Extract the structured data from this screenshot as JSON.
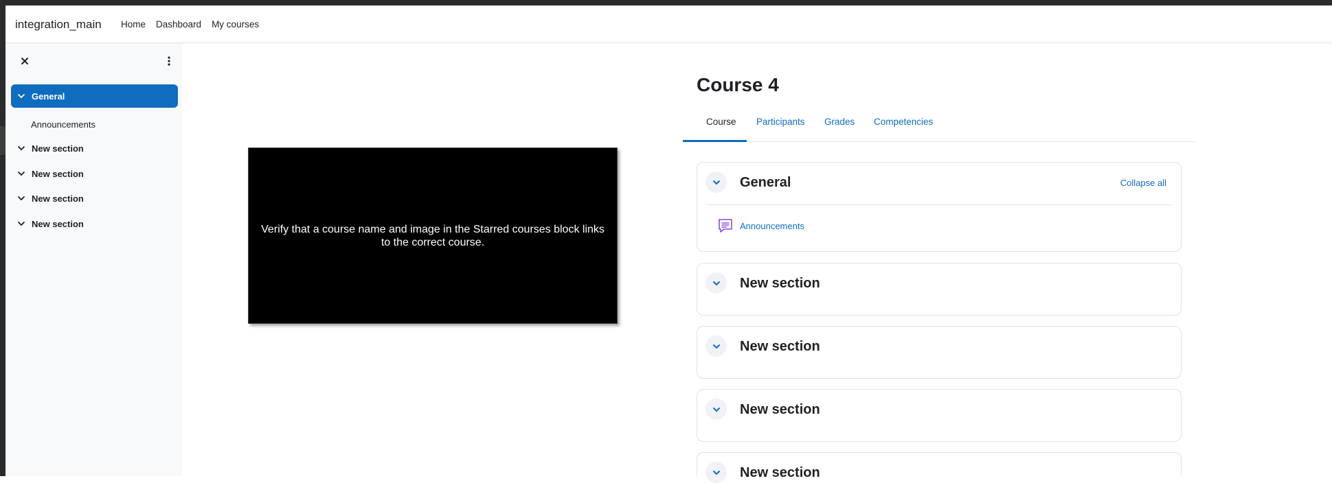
{
  "navbar": {
    "brand": "integration_main",
    "links": [
      "Home",
      "Dashboard",
      "My courses"
    ]
  },
  "drawer": {
    "close_icon": "close-icon",
    "menu_icon": "kebab-menu-icon",
    "items": [
      {
        "label": "General",
        "active": true
      },
      {
        "label": "Announcements",
        "sub": true
      },
      {
        "label": "New section"
      },
      {
        "label": "New section"
      },
      {
        "label": "New section"
      },
      {
        "label": "New section"
      }
    ]
  },
  "slide": {
    "text": "Verify that a course name and image in the Starred courses block links to the correct course."
  },
  "course": {
    "title": "Course 4",
    "tabs": [
      "Course",
      "Participants",
      "Grades",
      "Competencies"
    ],
    "active_tab": "Course",
    "collapse_all_label": "Collapse all",
    "sections": [
      {
        "title": "General",
        "activities": [
          {
            "label": "Announcements",
            "icon": "forum-icon"
          }
        ]
      },
      {
        "title": "New section"
      },
      {
        "title": "New section"
      },
      {
        "title": "New section"
      },
      {
        "title": "New section"
      }
    ]
  },
  "colors": {
    "accent": "#0f6cbf",
    "drawer_bg": "#f8f9fa",
    "forum_icon": "#8c4bd6"
  }
}
